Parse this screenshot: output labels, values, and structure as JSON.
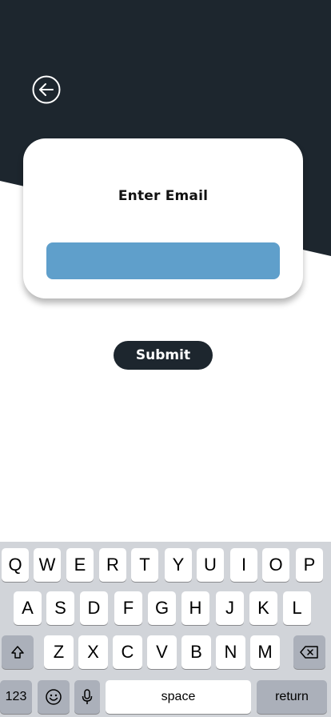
{
  "header": {
    "back_icon": "arrow-left-circle-icon",
    "background_color": "#1d262e"
  },
  "card": {
    "title": "Enter Email",
    "email_value": "",
    "email_placeholder": "",
    "input_color": "#5f9fcb"
  },
  "submit": {
    "label": "Submit",
    "color": "#1d262e"
  },
  "keyboard": {
    "row1": [
      "Q",
      "W",
      "E",
      "R",
      "T",
      "Y",
      "U",
      "I",
      "O",
      "P"
    ],
    "row2": [
      "A",
      "S",
      "D",
      "F",
      "G",
      "H",
      "J",
      "K",
      "L"
    ],
    "row3": [
      "Z",
      "X",
      "C",
      "V",
      "B",
      "N",
      "M"
    ],
    "shift_icon": "shift-icon",
    "delete_icon": "backspace-icon",
    "numbers_label": "123",
    "emoji_icon": "emoji-icon",
    "mic_icon": "microphone-icon",
    "space_label": "space",
    "return_label": "return"
  }
}
